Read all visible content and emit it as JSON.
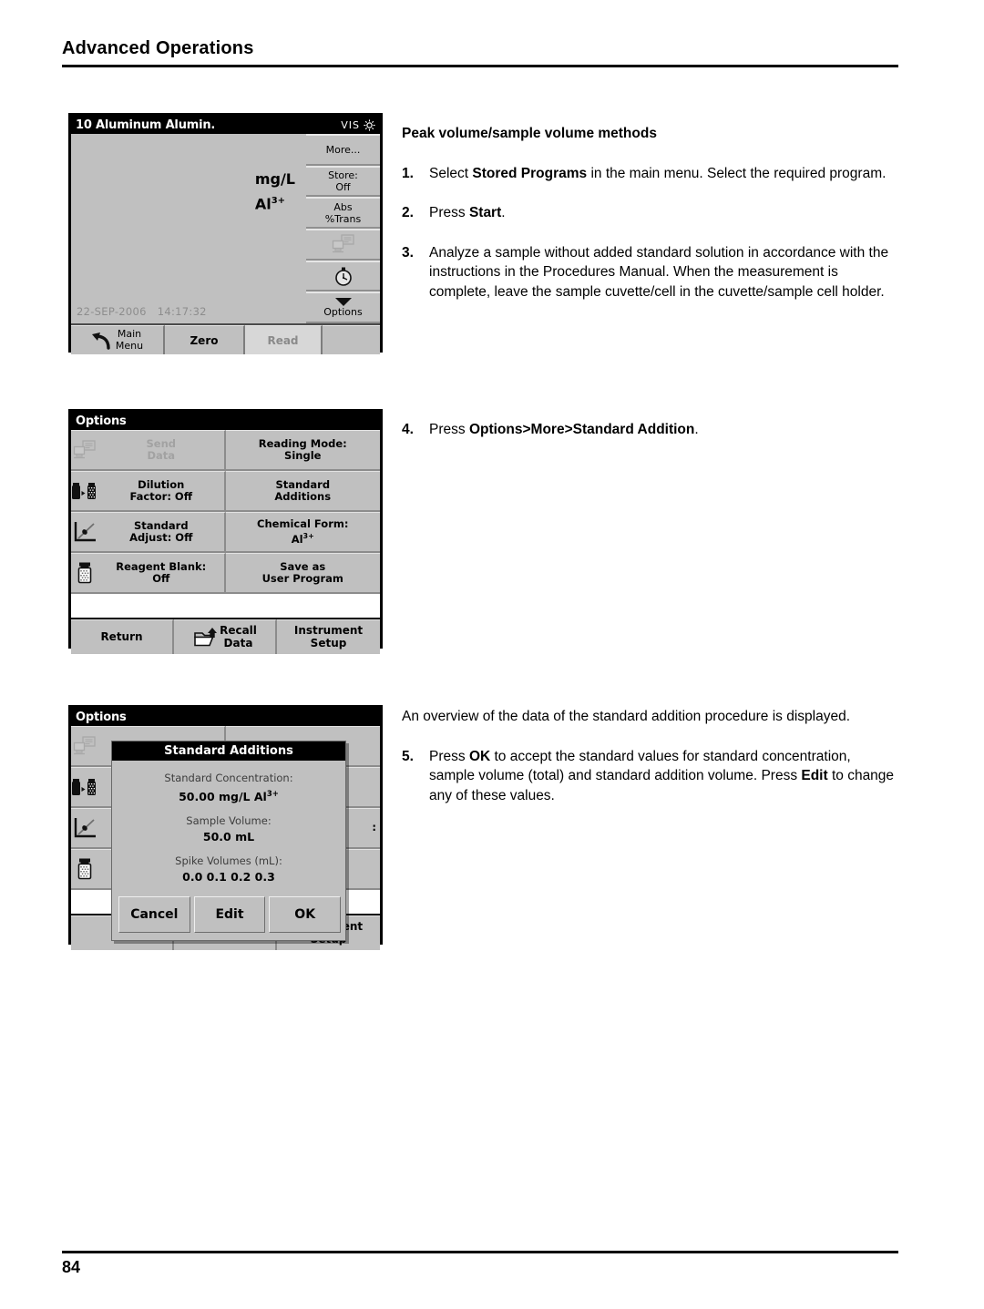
{
  "page": {
    "header_title": "Advanced Operations",
    "page_number": "84"
  },
  "text_column": {
    "section_heading": "Peak volume/sample volume methods",
    "steps": [
      {
        "num": "1.",
        "parts": [
          {
            "t": "Select ",
            "b": false
          },
          {
            "t": "Stored Programs",
            "b": true
          },
          {
            "t": " in the main menu. Select the required program.",
            "b": false
          }
        ]
      },
      {
        "num": "2.",
        "parts": [
          {
            "t": "Press ",
            "b": false
          },
          {
            "t": "Start",
            "b": true
          },
          {
            "t": ".",
            "b": false
          }
        ]
      },
      {
        "num": "3.",
        "parts": [
          {
            "t": "Analyze a sample without added standard solution in accordance with the instructions in the Procedures Manual. When the measurement is complete, leave the sample cuvette/cell in the cuvette/sample cell holder.",
            "b": false
          }
        ]
      },
      {
        "num": "4.",
        "parts": [
          {
            "t": "Press ",
            "b": false
          },
          {
            "t": "Options>More>Standard Addition",
            "b": true
          },
          {
            "t": ".",
            "b": false
          }
        ]
      }
    ],
    "overview_paragraph": "An overview of the data of the standard addition procedure is displayed.",
    "step5": {
      "num": "5.",
      "parts": [
        {
          "t": "Press ",
          "b": false
        },
        {
          "t": "OK",
          "b": true
        },
        {
          "t": " to accept the standard values for standard concentration, sample volume (total) and standard addition volume. Press ",
          "b": false
        },
        {
          "t": "Edit",
          "b": true
        },
        {
          "t": " to change any of these values.",
          "b": false
        }
      ]
    }
  },
  "measure_screen": {
    "title": "10 Aluminum Alumin.",
    "mode_label": "VIS",
    "sun_icon": "sun-icon",
    "unit": "mg/L",
    "analyte": "Al",
    "analyte_charge": "3+",
    "date": "22-SEP-2006",
    "time": "14:17:32",
    "side_buttons": [
      {
        "label": "More...",
        "icon": "",
        "disabled": false
      },
      {
        "label": "Store:\nOff",
        "line1": "Store:",
        "line2": "Off",
        "disabled": false
      },
      {
        "label": "Abs\n%Trans",
        "line1": "Abs",
        "line2": "%Trans",
        "disabled": false
      },
      {
        "label": "",
        "icon": "send-data-icon",
        "disabled": true
      },
      {
        "label": "",
        "icon": "timer-icon",
        "disabled": false
      },
      {
        "label": "Options",
        "icon": "chevron-down-icon",
        "disabled": false
      }
    ],
    "bottom_buttons": [
      {
        "line1": "Main",
        "line2": "Menu",
        "icon": "back-arrow-icon",
        "disabled": false
      },
      {
        "label": "Zero",
        "disabled": false
      },
      {
        "label": "Read",
        "disabled": true
      }
    ]
  },
  "options_screen": {
    "title": "Options",
    "cells": [
      {
        "icon": "send-data-icon",
        "line1": "Send",
        "line2": "Data",
        "disabled": true
      },
      {
        "icon": "",
        "line1": "Reading Mode:",
        "line2": "Single",
        "disabled": false
      },
      {
        "icon": "dilution-icon",
        "line1": "Dilution",
        "line2": "Factor: Off",
        "disabled": false
      },
      {
        "icon": "",
        "line1": "Standard",
        "line2": "Additions",
        "disabled": false
      },
      {
        "icon": "standard-adjust-icon",
        "line1": "Standard",
        "line2": "Adjust: Off",
        "disabled": false
      },
      {
        "icon": "",
        "line1": "Chemical Form:",
        "line2": "Al3+",
        "disabled": false
      },
      {
        "icon": "reagent-blank-icon",
        "line1": "Reagent Blank:",
        "line2": "Off",
        "disabled": false
      },
      {
        "icon": "",
        "line1": "Save as",
        "line2": "User Program",
        "disabled": false
      }
    ],
    "footer": [
      {
        "label": "Return",
        "icon": ""
      },
      {
        "line1": "Recall",
        "line2": "Data",
        "icon": "recall-folder-icon"
      },
      {
        "line1": "Instrument",
        "line2": "Setup",
        "icon": ""
      }
    ]
  },
  "standard_additions_dialog": {
    "title": "Standard Additions",
    "fields": [
      {
        "label": "Standard Concentration:",
        "value": "50.00 mg/L Al",
        "sup": "3+"
      },
      {
        "label": "Sample Volume:",
        "value": "50.0 mL",
        "sup": ""
      },
      {
        "label": "Spike Volumes (mL):",
        "value": "0.0 0.1 0.2 0.3",
        "sup": ""
      }
    ],
    "buttons": [
      {
        "label": "Cancel"
      },
      {
        "label": "Edit"
      },
      {
        "label": "OK"
      }
    ]
  },
  "colors": {
    "screen_bg": "#c0c0c0",
    "titlebar_bg": "#000000",
    "disabled_text": "#a2a2a2",
    "stamp_text": "#8d8d8d"
  }
}
